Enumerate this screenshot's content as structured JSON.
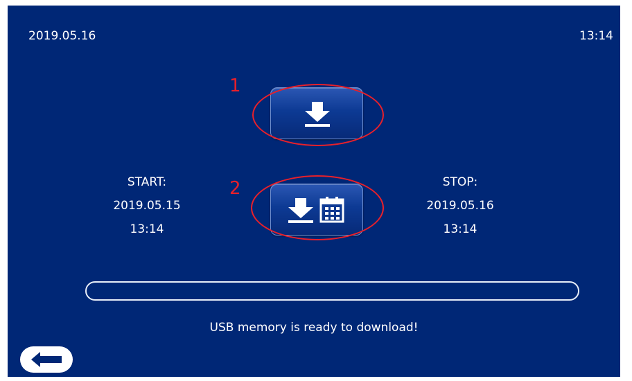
{
  "header": {
    "date": "2019.05.16",
    "time": "13:14"
  },
  "annotations": {
    "marker_1": "1",
    "marker_2": "2"
  },
  "buttons": {
    "download_all_icon": "download-icon",
    "download_range_icons": [
      "download-icon",
      "calendar-icon"
    ]
  },
  "range": {
    "start_label": "START:",
    "start_date": "2019.05.15",
    "start_time": "13:14",
    "stop_label": "STOP:",
    "stop_date": "2019.05.16",
    "stop_time": "13:14"
  },
  "progress": {
    "value": 0
  },
  "status_message": "USB memory is ready to download!",
  "colors": {
    "background": "#002776",
    "annotation": "#e8202a",
    "text": "#ffffff"
  }
}
